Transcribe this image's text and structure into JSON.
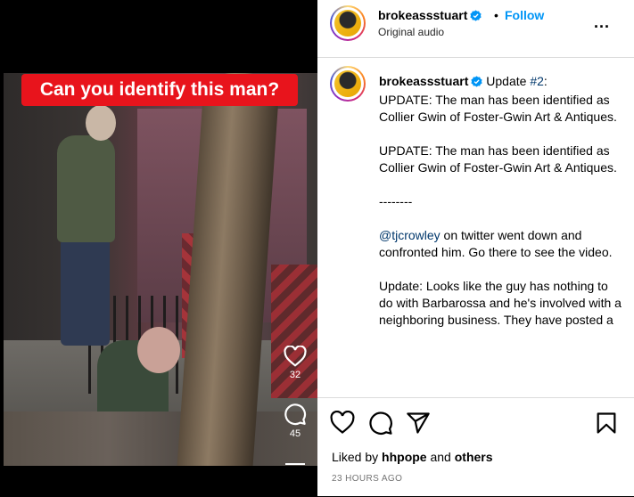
{
  "media": {
    "headline": "Can you identify this man?",
    "like_count": "32",
    "comment_count": "45"
  },
  "header": {
    "username": "brokeassstuart",
    "dot": "•",
    "follow_label": "Follow",
    "audio": "Original audio",
    "more": "..."
  },
  "caption": {
    "username": "brokeassstuart",
    "first_line": "Update ",
    "hashtag": "#2",
    "first_line_end": ":",
    "p1": "UPDATE: The man has been identified as Collier Gwin of Foster-Gwin Art & Antiques.",
    "p2": "UPDATE: The man has been identified as Collier Gwin of Foster-Gwin Art & Antiques.",
    "p3": "--------",
    "mention": "@tjcrowley",
    "p4_rest": " on twitter went down and confronted him. Go there to see the video.",
    "p5": "Update: Looks like the guy has nothing to do with Barbarossa and he's involved with a neighboring business. They have posted a"
  },
  "actions": {
    "liked_by_prefix": "Liked by ",
    "liked_by_user": "hhpope",
    "liked_by_mid": " and ",
    "liked_by_others": "others",
    "timestamp": "23 HOURS AGO"
  },
  "colors": {
    "headline_bg": "#e8141c",
    "follow": "#0095f6",
    "verified": "#0095f6",
    "link": "#00376b"
  }
}
